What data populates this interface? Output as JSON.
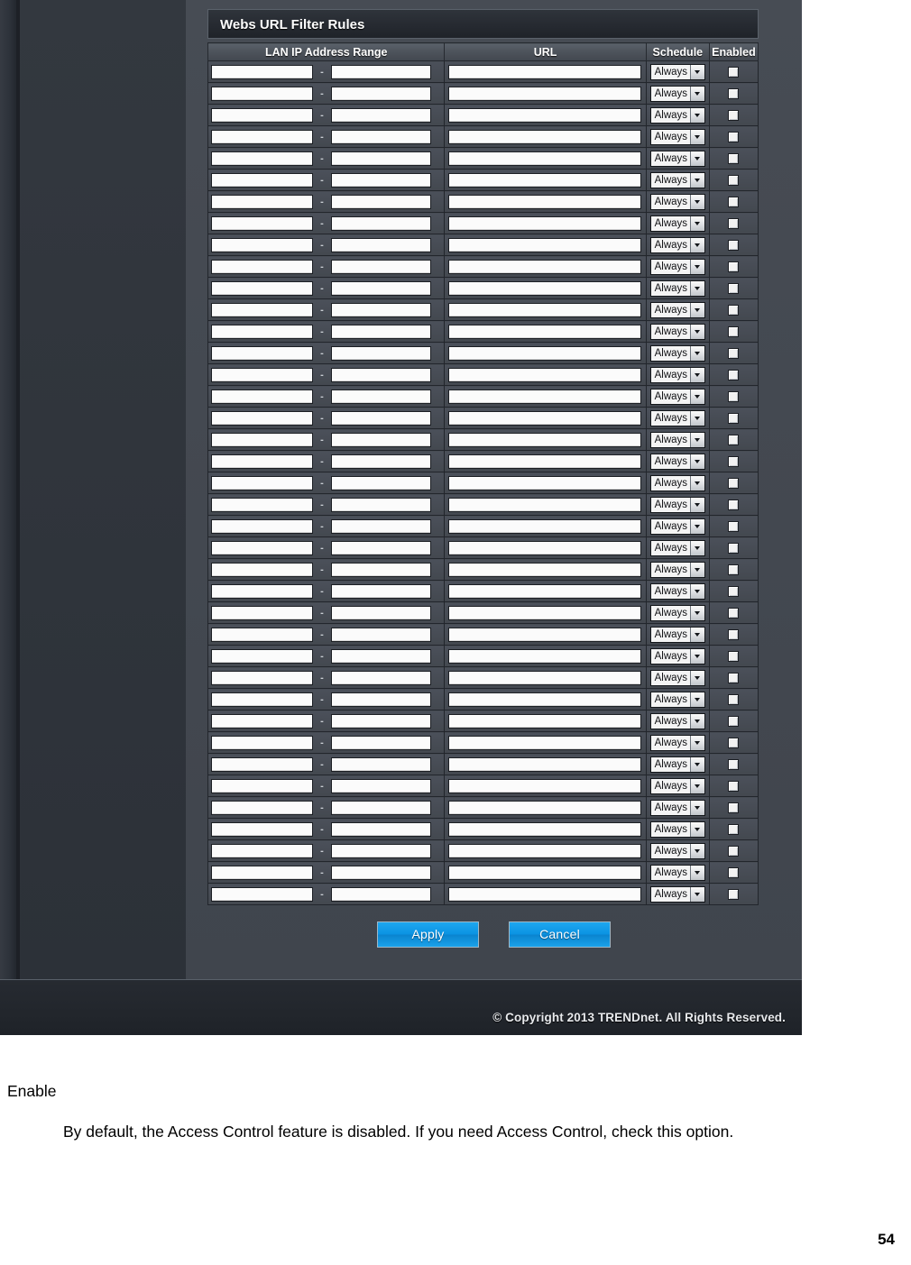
{
  "screenshot": {
    "panel": {
      "title": "Webs URL Filter Rules",
      "columns": {
        "lan_ip": "LAN IP Address Range",
        "url": "URL",
        "schedule": "Schedule",
        "enabled": "Enabled"
      },
      "row_count": 39,
      "row_defaults": {
        "ip_start": "",
        "ip_end": "",
        "separator": "-",
        "url": "",
        "schedule": "Always",
        "enabled": false
      },
      "schedule_options": [
        "Always"
      ]
    },
    "buttons": {
      "apply": "Apply",
      "cancel": "Cancel"
    },
    "footer": {
      "copyright": "© Copyright 2013 TRENDnet. All Rights Reserved."
    },
    "colors": {
      "button_accent": "#0b93e3",
      "panel_background": "#40454d",
      "title_bar": "#272b32",
      "header_row": "#4d535b"
    }
  },
  "document": {
    "term": "Enable",
    "description": "By default, the Access Control feature is disabled. If you need Access Control, check this option.",
    "page_number": "54"
  }
}
